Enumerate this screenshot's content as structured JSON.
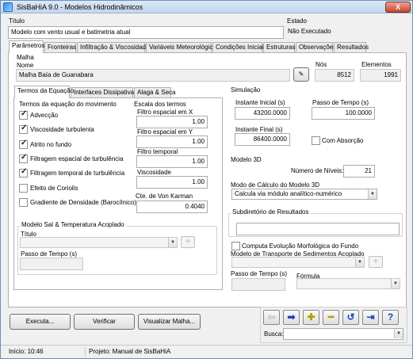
{
  "window": {
    "title": "SisBaHiA 9.0 - Modelos Hidrodinâmicos",
    "close_label": "X"
  },
  "header": {
    "title_label": "Título",
    "title_value": "Modelo com vento usual e batimetria atual",
    "state_label": "Estado",
    "state_value": "Não Executado"
  },
  "main_tabs": [
    "Parâmetros",
    "Fronteiras",
    "Infiltração & Viscosidade",
    "Variáveis Meteorológicas",
    "Condições Iniciais",
    "Estruturas",
    "Observações",
    "Resultados"
  ],
  "malha": {
    "section_label": "Malha",
    "name_label": "Nome",
    "name_value": "Malha Baía de Guanabara",
    "nodes_label": "Nós",
    "nodes_value": "8512",
    "elements_label": "Elementos",
    "elements_value": "1991"
  },
  "sub_tabs": [
    "Termos da Equação",
    "Interfaces Dissipativas",
    "Alaga & Seca"
  ],
  "terms": {
    "group_label": "Termos da equação do movimento",
    "items": [
      {
        "label": "Advecção",
        "checked": true
      },
      {
        "label": "Viscosidade turbulenta",
        "checked": true
      },
      {
        "label": "Atrito no fundo",
        "checked": true
      },
      {
        "label": "Filtragem espacial de turbulência",
        "checked": true
      },
      {
        "label": "Filtragem temporal de turbulência",
        "checked": true
      },
      {
        "label": "Efeito de Coriolis",
        "checked": false
      },
      {
        "label": "Gradiente de Densidade (Barocílnico)",
        "checked": false
      }
    ]
  },
  "scales": {
    "group_label": "Escala dos termos",
    "filtro_x_label": "Filtro espacial em X",
    "filtro_x_value": "1.00",
    "filtro_y_label": "Filtro espacial em Y",
    "filtro_y_value": "1.00",
    "filtro_t_label": "Filtro temporal",
    "filtro_t_value": "1.00",
    "viscosidade_label": "Viscosidade",
    "viscosidade_value": "1.00",
    "karman_label": "Cte. de Von Karman",
    "karman_value": "0.4040"
  },
  "sal_temp": {
    "group_label": "Modelo Sal & Temperatura Acoplado",
    "title_label": "Título",
    "step_label": "Passo de Tempo (s)"
  },
  "simulation": {
    "group_label": "Simulação",
    "start_label": "Instante Inicial (s)",
    "start_value": "43200.0000",
    "step_label": "Passo de Tempo (s)",
    "step_value": "100.0000",
    "end_label": "Instante Final (s)",
    "end_value": "86400.0000",
    "absorcao_label": "Com Absorção"
  },
  "model3d": {
    "group_label": "Modelo 3D",
    "levels_label": "Número de Níveis:",
    "levels_value": "21",
    "calc_label": "Modo de Cálculo do Modelo 3D",
    "calc_value": "Calcula via módulo analítico-numérico"
  },
  "results": {
    "group_label": "Subdiretório de Resultados"
  },
  "morpho": {
    "checkbox_label": "Computa Evolução Morfológica do Fundo",
    "transport_label": "Modelo de Transporte de Sedimentos Acoplado",
    "step_label": "Passo de Tempo (s)",
    "formula_label": "Fórmula"
  },
  "buttons": {
    "run": "Executa...",
    "verify": "Verificar",
    "view_mesh": "Visualizar Malha..."
  },
  "nav": {
    "search_label": "Busca:",
    "help_label": "?"
  },
  "status": {
    "start": "Início: 10:46",
    "project": "Projeto: Manual de SisBaHiA"
  }
}
